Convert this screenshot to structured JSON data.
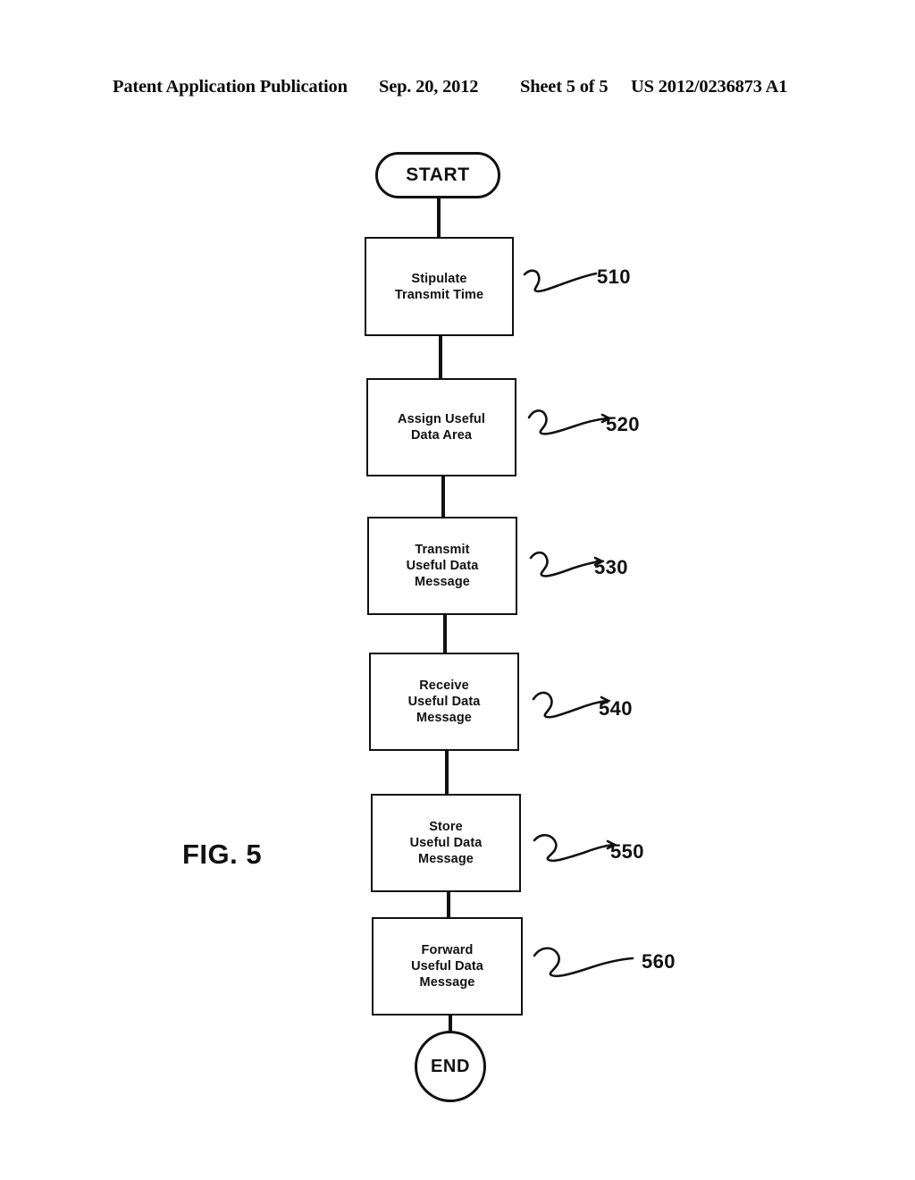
{
  "header": {
    "publication": "Patent Application Publication",
    "date": "Sep. 20, 2012",
    "sheet": "Sheet 5 of 5",
    "patent_number": "US 2012/0236873 A1"
  },
  "figure": {
    "label": "FIG. 5",
    "title": "",
    "colors": {
      "ink": "#111111",
      "background": "#ffffff"
    }
  },
  "chart_data": {
    "type": "diagram",
    "diagram_type": "flowchart",
    "title": "FIG. 5",
    "orientation": "vertical",
    "nodes": [
      {
        "id": "start",
        "shape": "stadium",
        "label": "START",
        "ref": ""
      },
      {
        "id": "n510",
        "shape": "rect",
        "label": "Stipulate\nTransmit Time",
        "ref": "510"
      },
      {
        "id": "n520",
        "shape": "rect",
        "label": "Assign Useful\nData Area",
        "ref": "520"
      },
      {
        "id": "n530",
        "shape": "rect",
        "label": "Transmit\nUseful Data\nMessage",
        "ref": "530"
      },
      {
        "id": "n540",
        "shape": "rect",
        "label": "Receive\nUseful Data\nMessage",
        "ref": "540"
      },
      {
        "id": "n550",
        "shape": "rect",
        "label": "Store\nUseful Data\nMessage",
        "ref": "550"
      },
      {
        "id": "n560",
        "shape": "rect",
        "label": "Forward\nUseful Data\nMessage",
        "ref": "560"
      },
      {
        "id": "end",
        "shape": "circle",
        "label": "END",
        "ref": ""
      }
    ],
    "edges": [
      {
        "from": "start",
        "to": "n510"
      },
      {
        "from": "n510",
        "to": "n520"
      },
      {
        "from": "n520",
        "to": "n530"
      },
      {
        "from": "n530",
        "to": "n540"
      },
      {
        "from": "n540",
        "to": "n550"
      },
      {
        "from": "n550",
        "to": "n560"
      },
      {
        "from": "n560",
        "to": "end"
      }
    ]
  },
  "nodes": {
    "start": {
      "label": "START"
    },
    "n510": {
      "label": "Stipulate\nTransmit Time",
      "ref": "510"
    },
    "n520": {
      "label": "Assign Useful\nData Area",
      "ref": "520"
    },
    "n530": {
      "label": "Transmit\nUseful Data\nMessage",
      "ref": "530"
    },
    "n540": {
      "label": "Receive\nUseful Data\nMessage",
      "ref": "540"
    },
    "n550": {
      "label": "Store\nUseful Data\nMessage",
      "ref": "550"
    },
    "n560": {
      "label": "Forward\nUseful Data\nMessage",
      "ref": "560"
    },
    "end": {
      "label": "END"
    }
  }
}
